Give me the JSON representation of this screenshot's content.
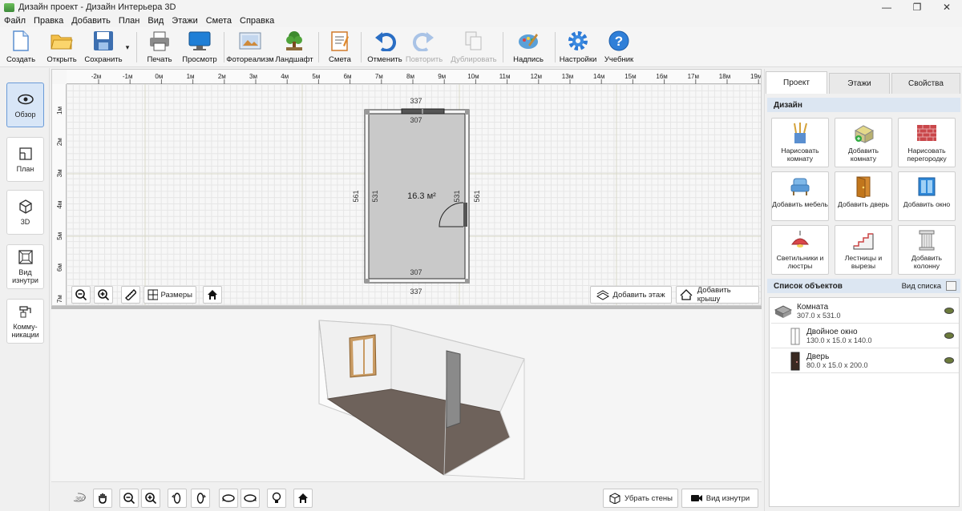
{
  "window": {
    "title": "Дизайн проект - Дизайн Интерьера 3D",
    "minimize": "—",
    "maximize": "❐",
    "close": "✕"
  },
  "menu": [
    "Файл",
    "Правка",
    "Добавить",
    "План",
    "Вид",
    "Этажи",
    "Смета",
    "Справка"
  ],
  "toolbar": {
    "new": "Создать",
    "open": "Открыть",
    "save": "Сохранить",
    "save_arrow": "▾",
    "print": "Печать",
    "preview": "Просмотр",
    "photo": "Фотореализм",
    "landscape": "Ландшафт",
    "estimate": "Смета",
    "undo": "Отменить",
    "redo": "Повторить",
    "duplicate": "Дублировать",
    "caption": "Надпись",
    "settings": "Настройки",
    "tutorial": "Учебник"
  },
  "leftbar": [
    {
      "label": "Обзор",
      "active": true
    },
    {
      "label": "План"
    },
    {
      "label": "3D"
    },
    {
      "label": "Вид изнутри"
    },
    {
      "label": "Комму-никации"
    }
  ],
  "plan": {
    "ruler_x": [
      "-2м",
      "-1м",
      "0м",
      "1м",
      "2м",
      "3м",
      "4м",
      "5м",
      "6м",
      "7м",
      "8м",
      "9м",
      "10м",
      "11м",
      "12м",
      "13м",
      "14м",
      "15м",
      "16м",
      "17м",
      "18м",
      "19м"
    ],
    "ruler_y": [
      "1м",
      "2м",
      "3м",
      "4м",
      "5м",
      "6м",
      "7м"
    ],
    "room_area": "16.3 м²",
    "dim_outer_top": "337",
    "dim_inner_top": "307",
    "dim_inner_bottom": "307",
    "dim_outer_bottom": "337",
    "dim_outer_left": "561",
    "dim_inner_left": "531",
    "dim_inner_right": "531",
    "dim_outer_right": "561",
    "sizes_label": "Размеры",
    "add_floor": "Добавить этаж",
    "add_roof": "Добавить крышу"
  },
  "view3d": {
    "remove_walls": "Убрать стены",
    "inside_view": "Вид изнутри",
    "rotate360": "360"
  },
  "rightpanel": {
    "tabs": [
      "Проект",
      "Этажи",
      "Свойства"
    ],
    "design_header": "Дизайн",
    "design_buttons": [
      "Нарисовать комнату",
      "Добавить комнату",
      "Нарисовать перегородку",
      "Добавить мебель",
      "Добавить дверь",
      "Добавить окно",
      "Светильники и люстры",
      "Лестницы и вырезы",
      "Добавить колонну"
    ],
    "objects_header": "Список объектов",
    "list_view": "Вид списка",
    "objects": [
      {
        "name": "Комната",
        "size": "307.0 x 531.0"
      },
      {
        "name": "Двойное окно",
        "size": "130.0 x 15.0 x 140.0"
      },
      {
        "name": "Дверь",
        "size": "80.0 x 15.0 x 200.0"
      }
    ]
  }
}
